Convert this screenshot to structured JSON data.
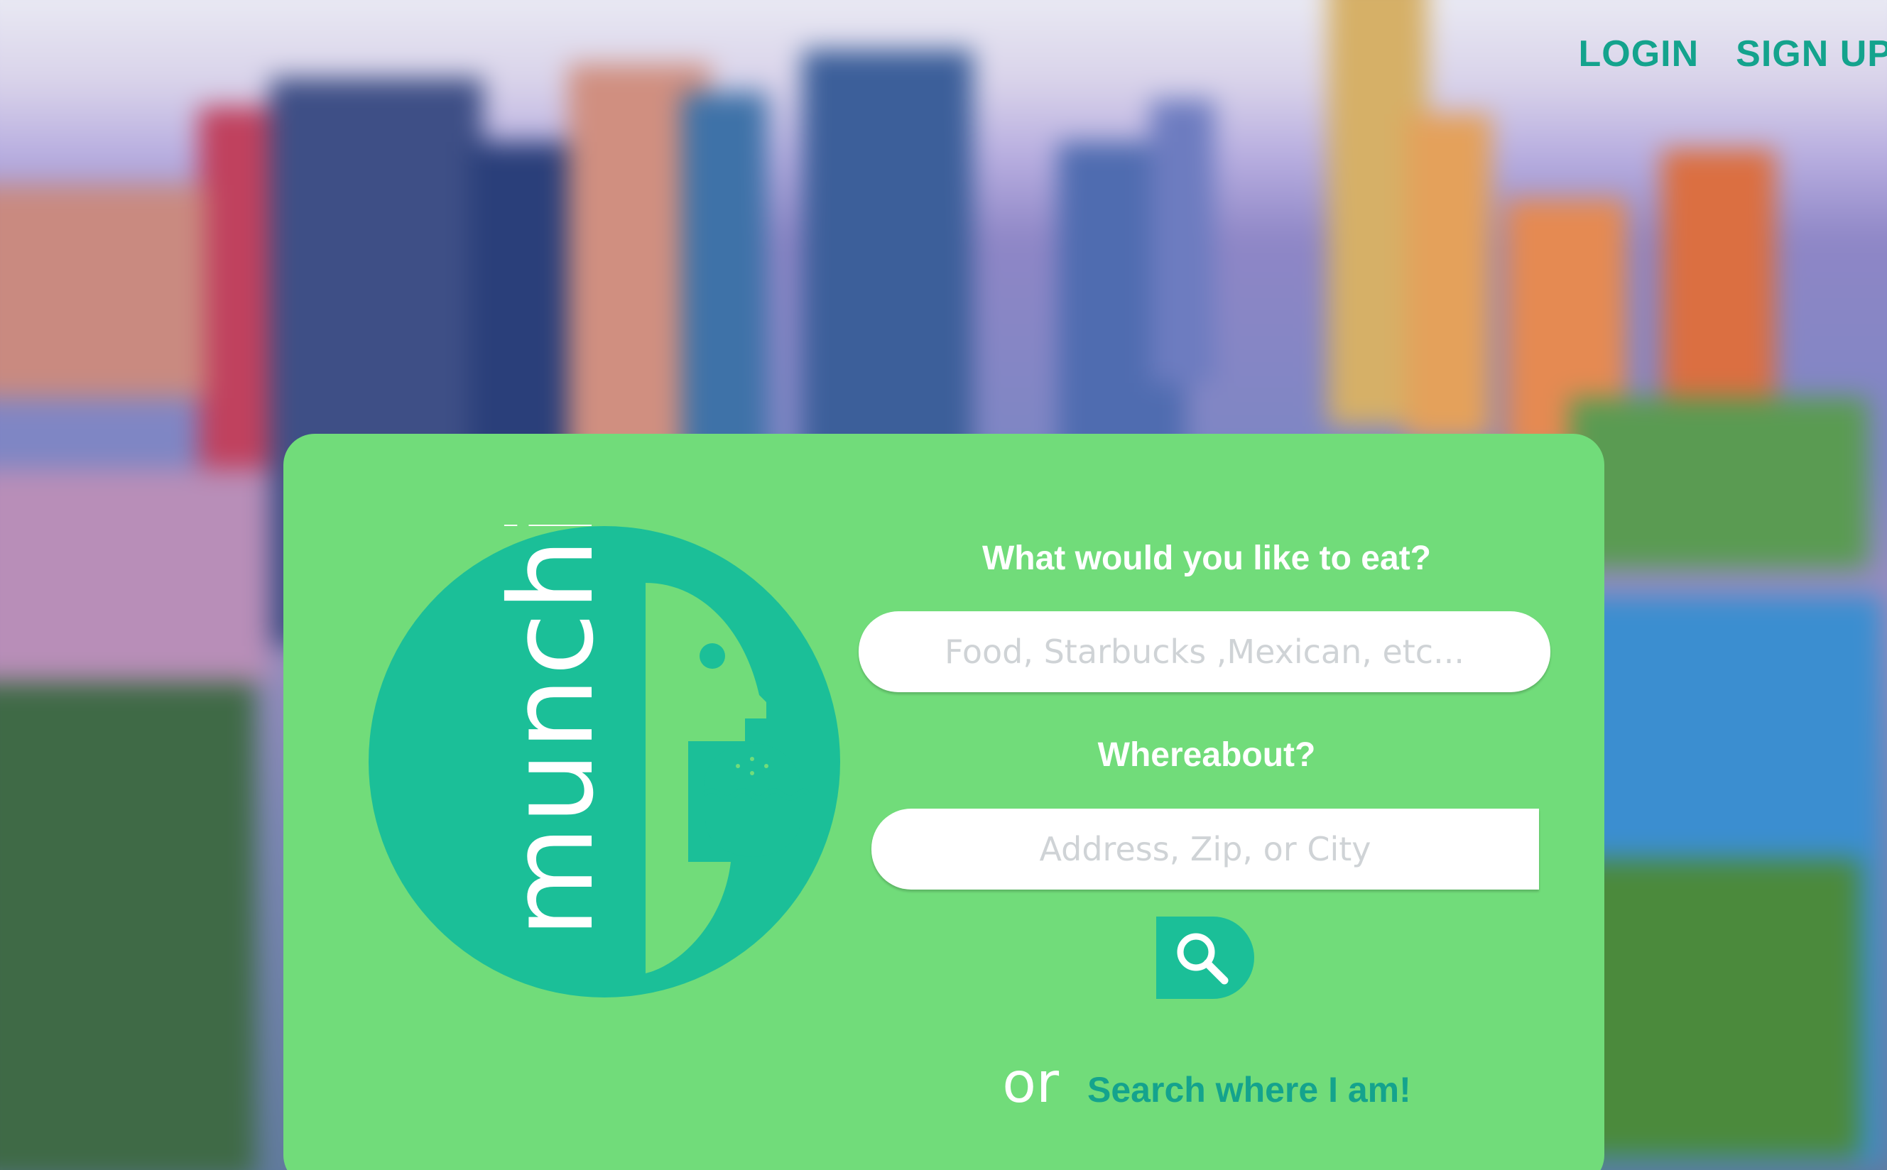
{
  "nav": {
    "login_label": "LOGIN",
    "signup_label": "SIGN UP"
  },
  "logo": {
    "wordmark": "munchi",
    "icons": [
      "face-silhouette-icon",
      "burger-icon"
    ]
  },
  "search": {
    "food_label": "What would you like to eat?",
    "food_placeholder": "Food, Starbucks ,Mexican, etc...",
    "location_label": "Whereabout?",
    "location_placeholder": "Address, Zip, or City",
    "button_icon": "search-icon"
  },
  "alt": {
    "or_text": "or",
    "geo_link": "Search where I am!"
  },
  "colors": {
    "card": "#71dc7a",
    "accent": "#1bbf98",
    "accent_text": "#14a38d",
    "white": "#ffffff"
  }
}
